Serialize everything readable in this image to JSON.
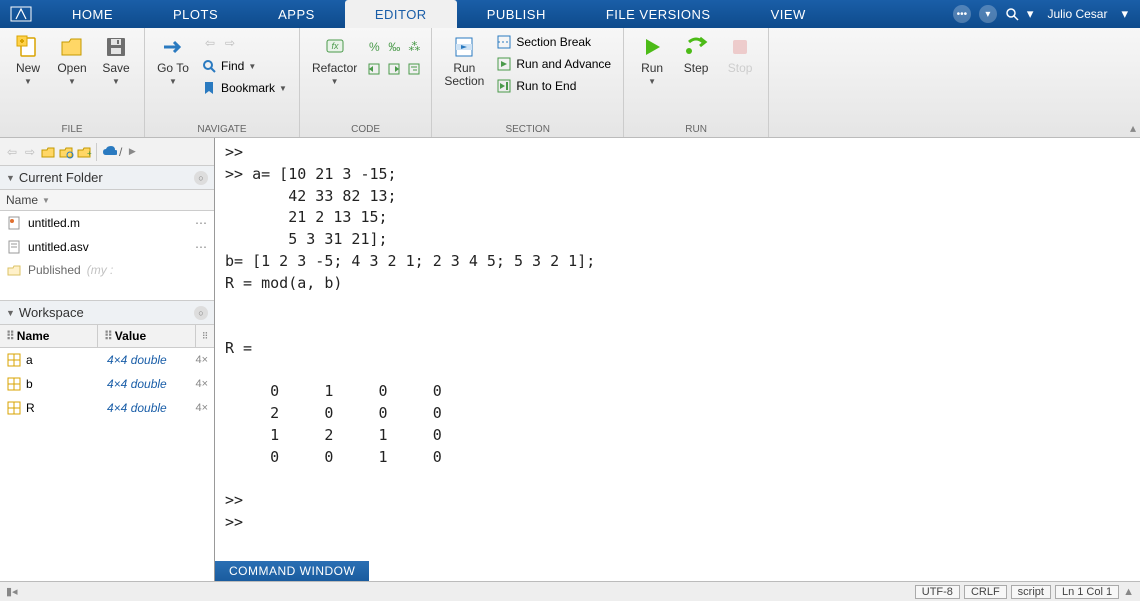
{
  "tabs": {
    "home": "HOME",
    "plots": "PLOTS",
    "apps": "APPS",
    "editor": "EDITOR",
    "publish": "PUBLISH",
    "file_versions": "FILE VERSIONS",
    "view": "VIEW"
  },
  "user": "Julio Cesar",
  "ribbon": {
    "file": {
      "new": "New",
      "open": "Open",
      "save": "Save",
      "label": "FILE"
    },
    "navigate": {
      "goto": "Go To",
      "find": "Find",
      "bookmark": "Bookmark",
      "label": "NAVIGATE"
    },
    "code": {
      "refactor": "Refactor",
      "label": "CODE"
    },
    "section": {
      "run_section": "Run\nSection",
      "section_break": "Section Break",
      "run_advance": "Run and Advance",
      "run_to_end": "Run to End",
      "label": "SECTION"
    },
    "run": {
      "run": "Run",
      "step": "Step",
      "stop": "Stop",
      "label": "RUN"
    }
  },
  "sidebar": {
    "current_folder": "Current Folder",
    "name_header": "Name",
    "files": [
      {
        "name": "untitled.m",
        "icon": "m-file"
      },
      {
        "name": "untitled.asv",
        "icon": "text-file"
      },
      {
        "name": "Published",
        "suffix": "(my :",
        "icon": "folder"
      }
    ],
    "workspace": "Workspace",
    "ws_headers": {
      "name": "Name",
      "value": "Value"
    },
    "ws_vars": [
      {
        "name": "a",
        "value": "4×4 double",
        "ext": "4×"
      },
      {
        "name": "b",
        "value": "4×4 double",
        "ext": "4×"
      },
      {
        "name": "R",
        "value": "4×4 double",
        "ext": "4×"
      }
    ]
  },
  "editor": {
    "content": ">>\n>> a= [10 21 3 -15;\n       42 33 82 13;\n       21 2 13 15;\n       5 3 31 21];\nb= [1 2 3 -5; 4 3 2 1; 2 3 4 5; 5 3 2 1];\nR = mod(a, b)\n\n\nR =\n\n     0     1     0     0\n     2     0     0     0\n     1     2     1     0\n     0     0     1     0\n\n>> \n>> ",
    "cmd_window_label": "COMMAND WINDOW"
  },
  "status": {
    "encoding": "UTF-8",
    "eol": "CRLF",
    "mode": "script",
    "pos": "Ln 1 Col 1"
  }
}
